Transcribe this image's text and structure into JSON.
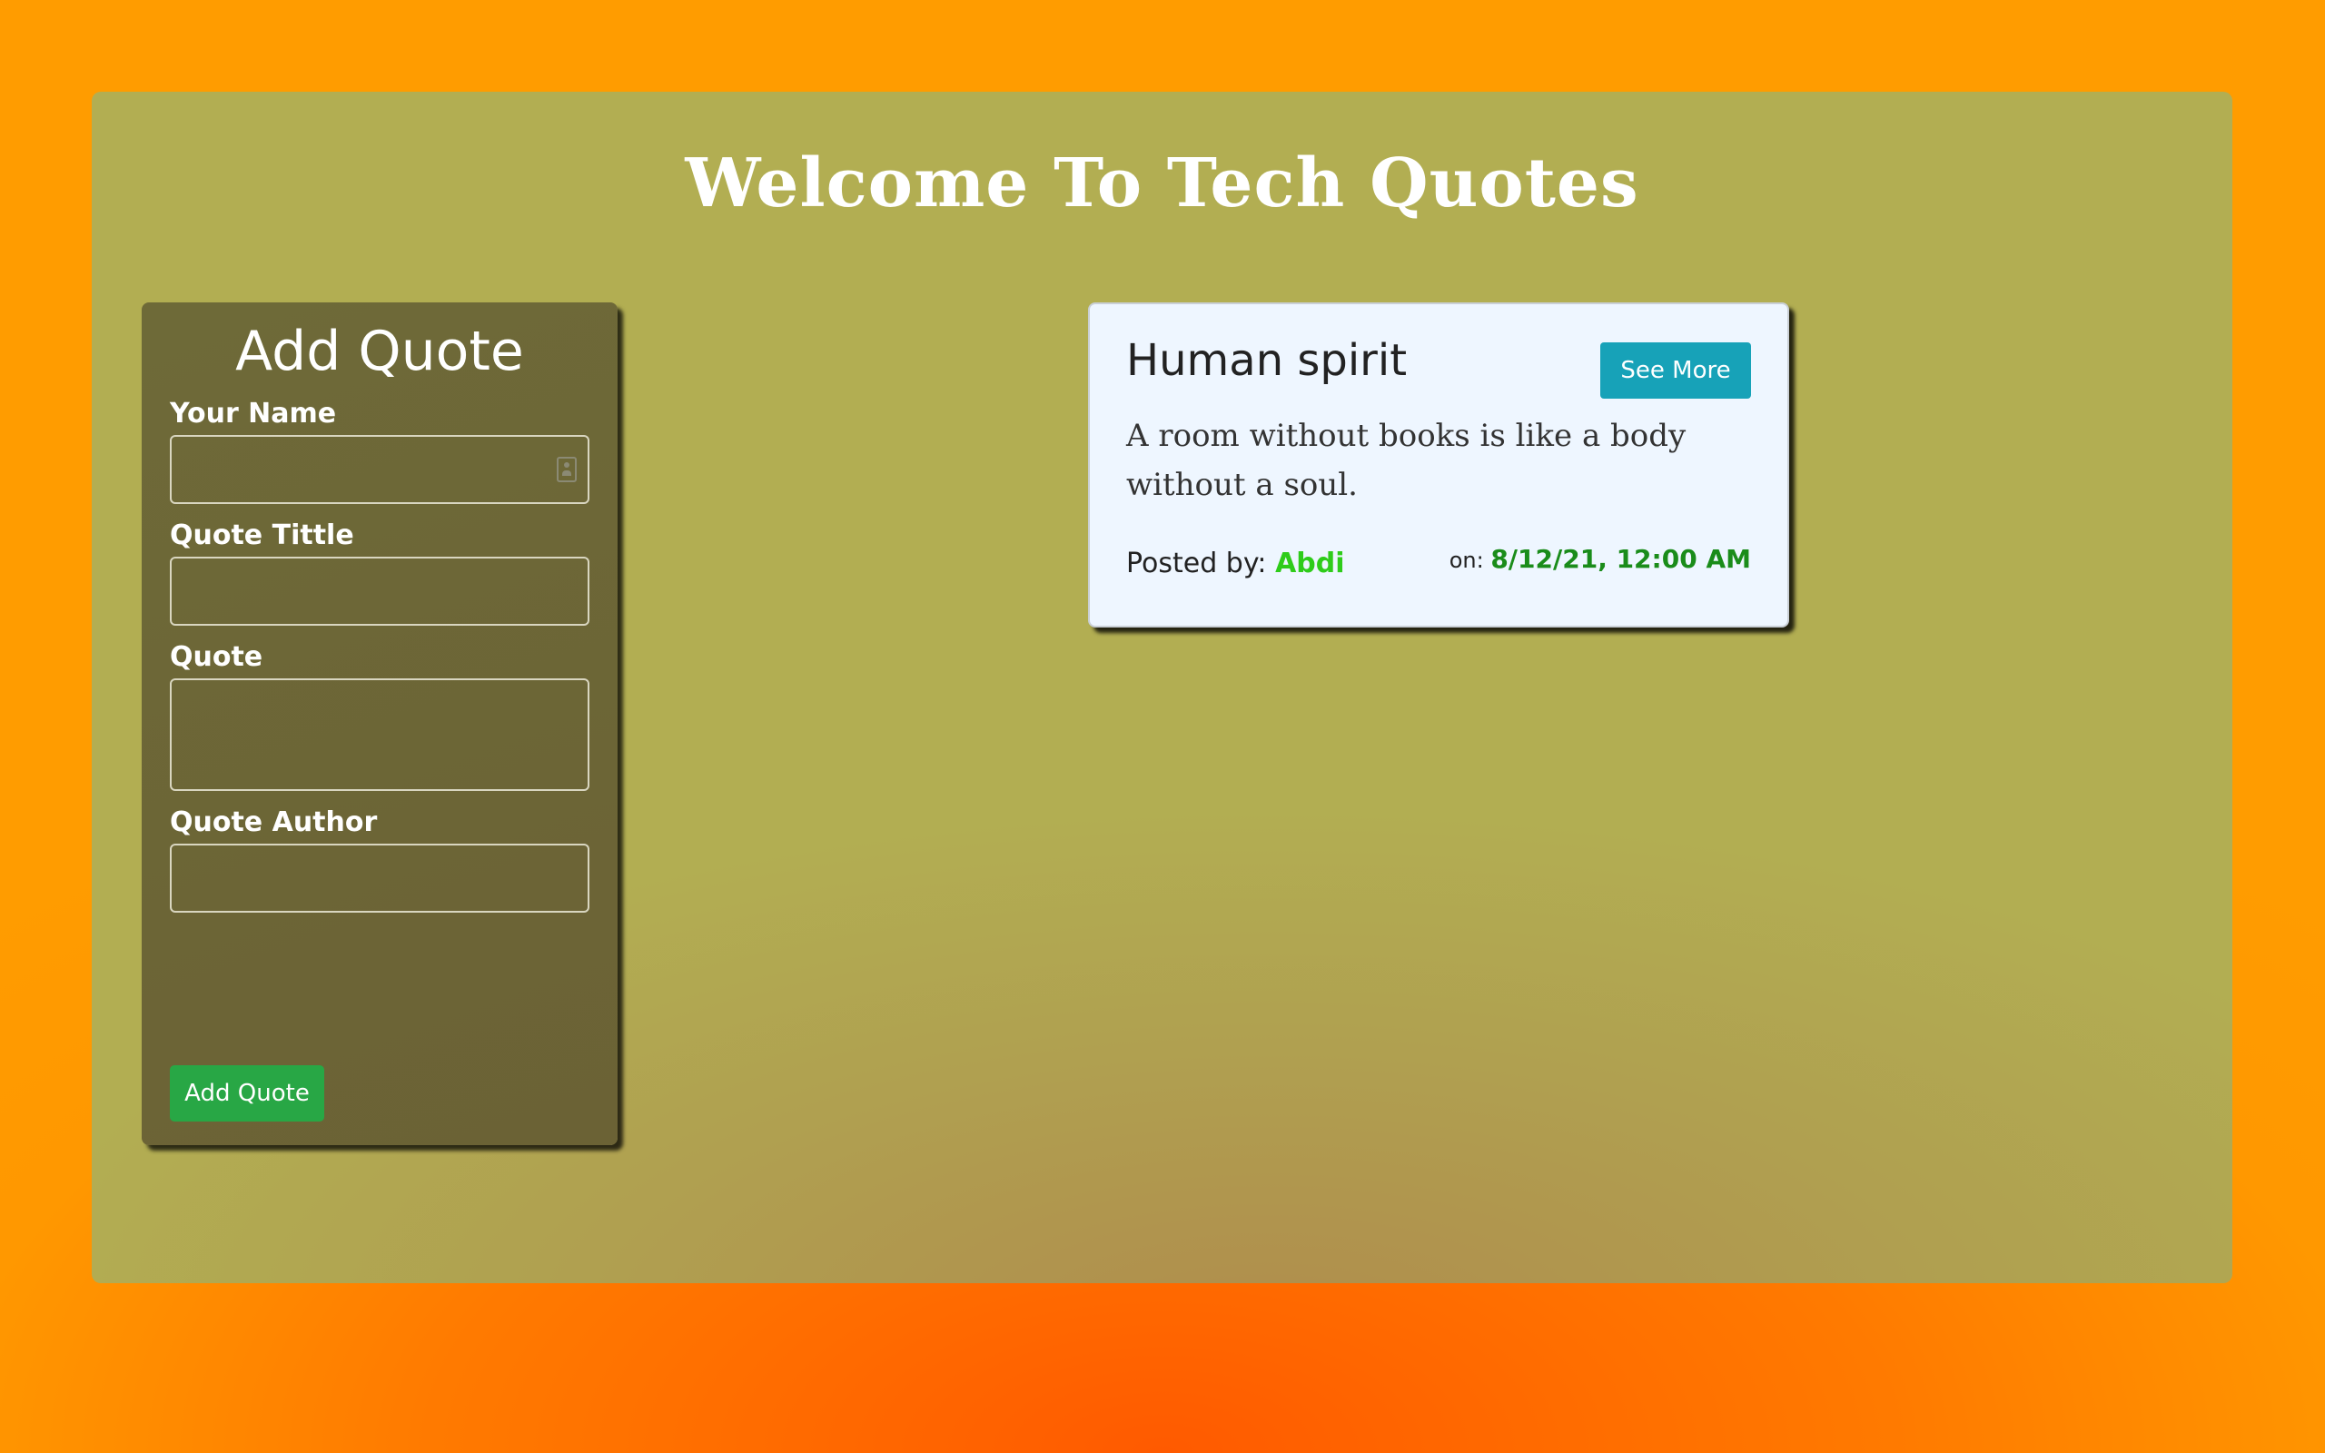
{
  "header": {
    "title": "Welcome To Tech Quotes"
  },
  "form": {
    "title": "Add Quote",
    "fields": [
      {
        "label": "Your Name",
        "value": "",
        "placeholder": ""
      },
      {
        "label": "Quote Tittle",
        "value": "",
        "placeholder": ""
      },
      {
        "label": "Quote",
        "value": "",
        "placeholder": ""
      },
      {
        "label": "Quote Author",
        "value": "",
        "placeholder": ""
      }
    ],
    "submit_label": "Add Quote"
  },
  "quotes": [
    {
      "title": "Human spirit",
      "see_more_label": "See More",
      "text": "A room without books is like a body without a soul.",
      "posted_by_label": "Posted by:",
      "author": "Abdi",
      "on_label": "on:",
      "date": "8/12/21, 12:00 AM"
    }
  ],
  "colors": {
    "page_background": "#ff9c00",
    "jumbotron": "#b2ae52",
    "form_card": "#6e6a38",
    "quote_card": "#eef6ff",
    "add_button": "#28a745",
    "see_more_button": "#17a2b8",
    "author": "#2ecc1a",
    "date": "#1a8c1a"
  }
}
